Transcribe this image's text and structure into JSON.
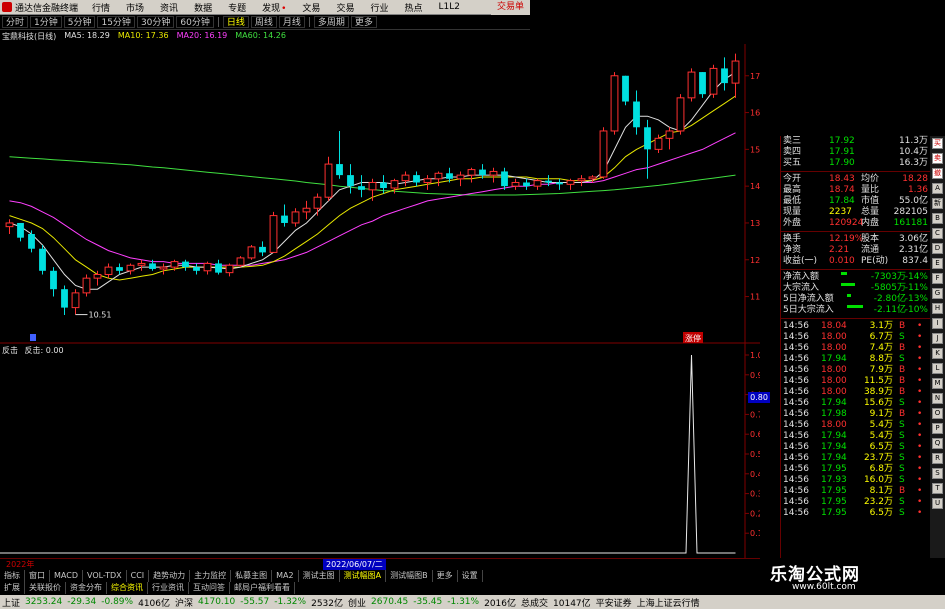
{
  "menubar": {
    "app_title": "通达信金融终端",
    "items": [
      "行情",
      "市场",
      "资讯",
      "数据",
      "专题",
      "发现",
      "文易",
      "交易",
      "行业",
      "热点",
      "L1L2"
    ],
    "right_item": "交易单"
  },
  "period_toolbar": {
    "items": [
      "分时",
      "1分钟",
      "5分钟",
      "15分钟",
      "30分钟",
      "60分钟",
      "日线",
      "周线",
      "月线",
      "多周期",
      "更多"
    ],
    "active": "日线"
  },
  "ma_legend": {
    "title": "宝鼎科技(日线)",
    "ma5": "MA5: 18.29",
    "ma10": "MA10: 17.36",
    "ma20": "MA20: 16.19",
    "ma60": "MA60: 14.26"
  },
  "chart_data": {
    "type": "candlestick",
    "price_axis_labels": [
      "17.00",
      "16.00",
      "15.00",
      "14.00",
      "13.00",
      "12.00",
      "11.00"
    ],
    "low_annotation": "10.51",
    "marker_label": "涨停",
    "sub_indicator": {
      "name": "反击",
      "value_label": "反击: 0.00",
      "axis_labels": [
        "1.00",
        "0.90",
        "0.80",
        "0.70",
        "0.60",
        "0.50",
        "0.40",
        "0.30",
        "0.20",
        "0.10"
      ],
      "highlight_label": "0.80"
    },
    "candles": [
      [
        12.9,
        13.1,
        12.7,
        13.0
      ],
      [
        13.0,
        13.0,
        12.5,
        12.6
      ],
      [
        12.7,
        12.8,
        12.2,
        12.3
      ],
      [
        12.3,
        12.4,
        11.6,
        11.7
      ],
      [
        11.7,
        11.8,
        11.0,
        11.2
      ],
      [
        11.2,
        11.3,
        10.5,
        10.7
      ],
      [
        10.7,
        11.2,
        10.51,
        11.1
      ],
      [
        11.1,
        11.6,
        11.0,
        11.5
      ],
      [
        11.5,
        11.7,
        11.3,
        11.6
      ],
      [
        11.6,
        11.9,
        11.5,
        11.8
      ],
      [
        11.8,
        11.9,
        11.6,
        11.7
      ],
      [
        11.7,
        11.9,
        11.6,
        11.85
      ],
      [
        11.85,
        12.0,
        11.7,
        11.9
      ],
      [
        11.9,
        12.0,
        11.7,
        11.75
      ],
      [
        11.75,
        11.9,
        11.6,
        11.8
      ],
      [
        11.8,
        12.0,
        11.7,
        11.95
      ],
      [
        11.95,
        12.0,
        11.7,
        11.8
      ],
      [
        11.8,
        11.9,
        11.6,
        11.7
      ],
      [
        11.7,
        11.95,
        11.6,
        11.9
      ],
      [
        11.9,
        12.0,
        11.6,
        11.65
      ],
      [
        11.65,
        11.9,
        11.55,
        11.85
      ],
      [
        11.85,
        12.1,
        11.8,
        12.05
      ],
      [
        12.05,
        12.4,
        12.0,
        12.35
      ],
      [
        12.35,
        12.5,
        12.1,
        12.2
      ],
      [
        12.2,
        13.3,
        12.2,
        13.2
      ],
      [
        13.2,
        13.5,
        12.9,
        13.0
      ],
      [
        13.0,
        13.4,
        12.9,
        13.3
      ],
      [
        13.3,
        13.6,
        13.1,
        13.4
      ],
      [
        13.4,
        13.8,
        13.2,
        13.7
      ],
      [
        13.7,
        14.8,
        13.6,
        14.6
      ],
      [
        14.6,
        15.5,
        14.2,
        14.3
      ],
      [
        14.3,
        14.6,
        13.8,
        14.0
      ],
      [
        14.0,
        14.3,
        13.7,
        13.9
      ],
      [
        13.9,
        14.2,
        13.6,
        14.1
      ],
      [
        14.1,
        14.3,
        13.8,
        13.95
      ],
      [
        13.95,
        14.2,
        13.8,
        14.15
      ],
      [
        14.15,
        14.4,
        14.0,
        14.3
      ],
      [
        14.3,
        14.4,
        14.0,
        14.1
      ],
      [
        14.1,
        14.3,
        13.9,
        14.2
      ],
      [
        14.2,
        14.4,
        14.0,
        14.35
      ],
      [
        14.35,
        14.5,
        14.1,
        14.2
      ],
      [
        14.2,
        14.4,
        14.0,
        14.3
      ],
      [
        14.3,
        14.5,
        14.1,
        14.45
      ],
      [
        14.45,
        14.6,
        14.2,
        14.3
      ],
      [
        14.3,
        14.5,
        14.1,
        14.4
      ],
      [
        14.4,
        14.5,
        13.9,
        14.0
      ],
      [
        14.0,
        14.2,
        13.9,
        14.1
      ],
      [
        14.1,
        14.2,
        13.9,
        14.0
      ],
      [
        14.0,
        14.2,
        13.9,
        14.15
      ],
      [
        14.15,
        14.3,
        14.0,
        14.1
      ],
      [
        14.1,
        14.2,
        13.9,
        14.05
      ],
      [
        14.05,
        14.2,
        13.9,
        14.15
      ],
      [
        14.15,
        14.3,
        14.0,
        14.2
      ],
      [
        14.2,
        14.3,
        14.1,
        14.25
      ],
      [
        14.25,
        15.6,
        14.2,
        15.5
      ],
      [
        15.5,
        17.1,
        15.4,
        17.0
      ],
      [
        17.0,
        17.0,
        16.2,
        16.3
      ],
      [
        16.3,
        16.6,
        15.4,
        15.6
      ],
      [
        15.6,
        15.8,
        14.2,
        15.0
      ],
      [
        15.0,
        15.4,
        14.9,
        15.3
      ],
      [
        15.3,
        15.6,
        15.0,
        15.5
      ],
      [
        15.5,
        16.5,
        15.4,
        16.4
      ],
      [
        16.4,
        17.2,
        16.3,
        17.1
      ],
      [
        17.1,
        17.1,
        16.4,
        16.5
      ],
      [
        16.5,
        17.3,
        16.4,
        17.2
      ],
      [
        17.2,
        17.5,
        16.6,
        16.8
      ],
      [
        16.8,
        17.6,
        16.4,
        17.4
      ]
    ],
    "ma5": [
      13.0,
      12.9,
      12.7,
      12.4,
      12.0,
      11.6,
      11.3,
      11.2,
      11.2,
      11.4,
      11.6,
      11.7,
      11.8,
      11.8,
      11.8,
      11.85,
      11.85,
      11.8,
      11.8,
      11.78,
      11.75,
      11.8,
      11.9,
      12.0,
      12.2,
      12.5,
      12.8,
      13.0,
      13.3,
      13.6,
      13.9,
      14.0,
      14.1,
      14.1,
      14.1,
      14.05,
      14.1,
      14.15,
      14.2,
      14.2,
      14.25,
      14.25,
      14.3,
      14.3,
      14.3,
      14.3,
      14.25,
      14.2,
      14.15,
      14.1,
      14.1,
      14.1,
      14.1,
      14.15,
      14.4,
      15.0,
      15.6,
      15.9,
      15.9,
      15.8,
      15.6,
      15.5,
      15.8,
      16.2,
      16.6,
      16.9,
      17.1
    ],
    "ma10": [
      13.2,
      13.1,
      13.0,
      12.85,
      12.6,
      12.3,
      12.0,
      11.8,
      11.6,
      11.5,
      11.45,
      11.5,
      11.55,
      11.6,
      11.7,
      11.75,
      11.8,
      11.8,
      11.8,
      11.8,
      11.8,
      11.8,
      11.82,
      11.85,
      11.95,
      12.1,
      12.3,
      12.5,
      12.7,
      12.95,
      13.2,
      13.4,
      13.55,
      13.7,
      13.8,
      13.9,
      13.95,
      14.0,
      14.05,
      14.1,
      14.15,
      14.2,
      14.2,
      14.25,
      14.25,
      14.25,
      14.25,
      14.25,
      14.2,
      14.2,
      14.2,
      14.15,
      14.15,
      14.15,
      14.25,
      14.5,
      14.8,
      15.0,
      15.15,
      15.3,
      15.45,
      15.5,
      15.65,
      15.85,
      16.05,
      16.25,
      16.45
    ],
    "ma20": [
      13.6,
      13.55,
      13.45,
      13.3,
      13.15,
      12.95,
      12.75,
      12.55,
      12.4,
      12.25,
      12.15,
      12.05,
      12.0,
      11.95,
      11.95,
      11.9,
      11.9,
      11.9,
      11.9,
      11.85,
      11.85,
      11.85,
      11.85,
      11.9,
      11.95,
      12.0,
      12.1,
      12.2,
      12.35,
      12.5,
      12.65,
      12.8,
      12.95,
      13.05,
      13.2,
      13.3,
      13.4,
      13.5,
      13.6,
      13.65,
      13.7,
      13.75,
      13.8,
      13.85,
      13.9,
      13.95,
      14.0,
      14.0,
      14.05,
      14.05,
      14.1,
      14.1,
      14.1,
      14.1,
      14.15,
      14.25,
      14.35,
      14.45,
      14.5,
      14.6,
      14.7,
      14.8,
      14.9,
      15.0,
      15.15,
      15.3,
      15.45
    ],
    "ma60": [
      14.8,
      14.78,
      14.76,
      14.74,
      14.72,
      14.7,
      14.68,
      14.66,
      14.64,
      14.62,
      14.6,
      14.58,
      14.55,
      14.52,
      14.5,
      14.47,
      14.44,
      14.41,
      14.38,
      14.35,
      14.32,
      14.29,
      14.26,
      14.23,
      14.2,
      14.17,
      14.14,
      14.1,
      14.07,
      14.04,
      14.0,
      13.97,
      13.94,
      13.91,
      13.88,
      13.86,
      13.84,
      13.82,
      13.8,
      13.79,
      13.78,
      13.77,
      13.76,
      13.76,
      13.76,
      13.76,
      13.76,
      13.77,
      13.78,
      13.79,
      13.8,
      13.82,
      13.84,
      13.86,
      13.88,
      13.9,
      13.93,
      13.96,
      13.99,
      14.02,
      14.06,
      14.1,
      14.14,
      14.18,
      14.22,
      14.26,
      14.3
    ],
    "signal": {
      "index": 62,
      "value": 1.0
    }
  },
  "quote_panel": {
    "rows_top": [
      {
        "label": "卖三",
        "value": "17.92",
        "right": "11.3万"
      },
      {
        "label": "卖四",
        "value": "17.91",
        "right": "10.4万"
      },
      {
        "label": "买五",
        "value": "17.90",
        "right": "16.3万"
      }
    ],
    "rows_main": [
      {
        "l1": "今开",
        "v1": "18.43",
        "l2": "均价",
        "v2": "18.28",
        "c1": "red",
        "c2": "red"
      },
      {
        "l1": "最高",
        "v1": "18.74",
        "l2": "量比",
        "v2": "1.36",
        "c1": "red",
        "c2": "red"
      },
      {
        "l1": "最低",
        "v1": "17.84",
        "l2": "市值",
        "v2": "55.0亿",
        "c1": "green",
        "c2": ""
      },
      {
        "l1": "现量",
        "v1": "2237",
        "l2": "总量",
        "v2": "282105",
        "c1": "yellow",
        "c2": ""
      },
      {
        "l1": "外盘",
        "v1": "120924",
        "l2": "内盘",
        "v2": "161181",
        "c1": "red",
        "c2": "green"
      }
    ],
    "rows_stats": [
      {
        "l1": "换手",
        "v1": "12.19%",
        "l2": "股本",
        "v2": "3.06亿"
      },
      {
        "l1": "净资",
        "v1": "2.21",
        "l2": "流通",
        "v2": "2.31亿"
      },
      {
        "l1": "收益(一)",
        "v1": "0.010",
        "l2": "PE(动)",
        "v2": "837.4"
      }
    ],
    "flows": [
      {
        "label": "净流入额",
        "value": "-7303万",
        "pct": "-14%"
      },
      {
        "label": "大宗流入",
        "value": "-5805万",
        "pct": "-11%"
      },
      {
        "label": "5日净流入额",
        "value": "-2.80亿",
        "pct": "-13%"
      },
      {
        "label": "5日大宗流入",
        "value": "-2.11亿",
        "pct": "-10%"
      }
    ],
    "ticks": [
      {
        "time": "14:56",
        "price": "18.04",
        "vol": "3.1万",
        "bs": "B"
      },
      {
        "time": "14:56",
        "price": "18.00",
        "vol": "6.7万",
        "bs": "S"
      },
      {
        "time": "14:56",
        "price": "18.00",
        "vol": "7.4万",
        "bs": "B"
      },
      {
        "time": "14:56",
        "price": "17.94",
        "vol": "8.8万",
        "bs": "S"
      },
      {
        "time": "14:56",
        "price": "18.00",
        "vol": "7.9万",
        "bs": "B"
      },
      {
        "time": "14:56",
        "price": "18.00",
        "vol": "11.5万",
        "bs": "B"
      },
      {
        "time": "14:56",
        "price": "18.00",
        "vol": "38.9万",
        "bs": "B"
      },
      {
        "time": "14:56",
        "price": "17.94",
        "vol": "15.6万",
        "bs": "S"
      },
      {
        "time": "14:56",
        "price": "17.98",
        "vol": "9.1万",
        "bs": "B"
      },
      {
        "time": "14:56",
        "price": "18.00",
        "vol": "5.4万",
        "bs": "S"
      },
      {
        "time": "14:56",
        "price": "17.94",
        "vol": "5.4万",
        "bs": "S"
      },
      {
        "time": "14:56",
        "price": "17.94",
        "vol": "6.5万",
        "bs": "S"
      },
      {
        "time": "14:56",
        "price": "17.94",
        "vol": "23.7万",
        "bs": "S"
      },
      {
        "time": "14:56",
        "price": "17.95",
        "vol": "6.8万",
        "bs": "S"
      },
      {
        "time": "14:56",
        "price": "17.93",
        "vol": "16.0万",
        "bs": "S"
      },
      {
        "time": "14:56",
        "price": "17.95",
        "vol": "8.1万",
        "bs": "B"
      },
      {
        "time": "14:56",
        "price": "17.95",
        "vol": "23.2万",
        "bs": "S"
      },
      {
        "time": "14:56",
        "price": "17.95",
        "vol": "6.5万",
        "bs": "S"
      }
    ]
  },
  "bottom": {
    "date_left": "2022年",
    "date_selected": "2022/06/07/二",
    "tabs": [
      "指标",
      "窗口",
      "MACD",
      "VOL-TDX",
      "CCI",
      "趋势动力",
      "主力监控",
      "私募主图",
      "MA2",
      "测试主图",
      "测试幅图A",
      "测试幅图B",
      "更多",
      "设置"
    ],
    "active_tab": "测试幅图A",
    "sub_tabs": [
      "扩展",
      "关联报价",
      "资金分布",
      "综合资讯",
      "行业资讯",
      "互动问答",
      "邮局户福利看看"
    ],
    "active_sub_tab": "综合资讯"
  },
  "statusbar": {
    "sh_label": "上证",
    "sh_value": "3253.24",
    "sh_change": "-29.34",
    "sh_pct": "-0.89%",
    "sh_amount": "4106亿",
    "sz_label": "沪深",
    "sz_value": "4170.10",
    "sz_change": "-55.57",
    "sz_pct": "-1.32%",
    "sz_amount": "2532亿",
    "cy_label": "创业",
    "cy_value": "2670.45",
    "cy_change": "-35.45",
    "cy_pct": "-1.31%",
    "cy_amount": "2016亿",
    "total_label": "总成交",
    "total_value": "10147亿",
    "broker": "平安证券",
    "market": "上海上证云行情"
  },
  "brand": {
    "name": "乐淘公式网",
    "url": "www.60lt.com"
  },
  "side_tools": [
    "买",
    "卖",
    "撤",
    "A",
    "新",
    "B",
    "C",
    "D",
    "E",
    "F",
    "G",
    "H",
    "I",
    "J",
    "K",
    "L",
    "M",
    "N",
    "O",
    "P",
    "Q",
    "R",
    "S",
    "T",
    "U"
  ],
  "colors": {
    "up": "#ff3030",
    "down": "#00e0e0",
    "ma5": "#e0e0e0",
    "ma10": "#e8e800",
    "ma20": "#ff40ff",
    "ma60": "#40e040"
  }
}
